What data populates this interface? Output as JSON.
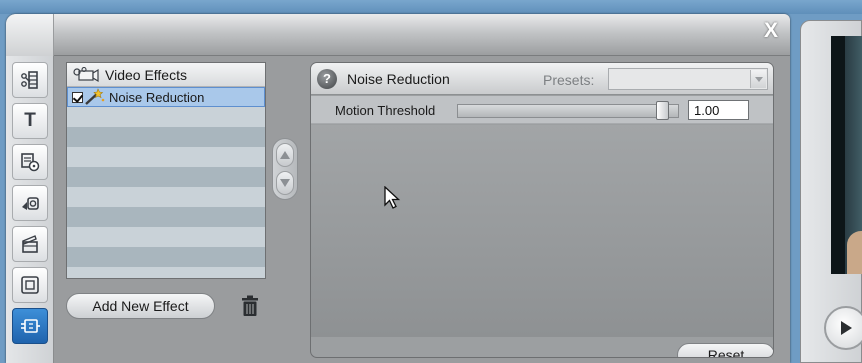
{
  "window": {
    "close_label": "X"
  },
  "sidebar": {
    "tools": [
      {
        "name": "edit-icon"
      },
      {
        "name": "title-icon",
        "label": "T"
      },
      {
        "name": "disc-menu-icon"
      },
      {
        "name": "audio-icon"
      },
      {
        "name": "clapper-icon"
      },
      {
        "name": "frame-icon"
      },
      {
        "name": "effects-icon",
        "active": true
      }
    ]
  },
  "effects_list": {
    "header": "Video Effects",
    "items": [
      {
        "label": "Noise Reduction",
        "checked": true,
        "selected": true
      }
    ]
  },
  "buttons": {
    "add_effect": "Add New Effect",
    "reset": "Reset"
  },
  "settings": {
    "title": "Noise Reduction",
    "presets_label": "Presets:",
    "presets_value": "",
    "params": [
      {
        "label": "Motion Threshold",
        "value": "1.00",
        "slider_fraction": 0.95
      }
    ]
  },
  "colors": {
    "accent": "#2f7ed0",
    "selected_row": "#a9c8ea"
  }
}
